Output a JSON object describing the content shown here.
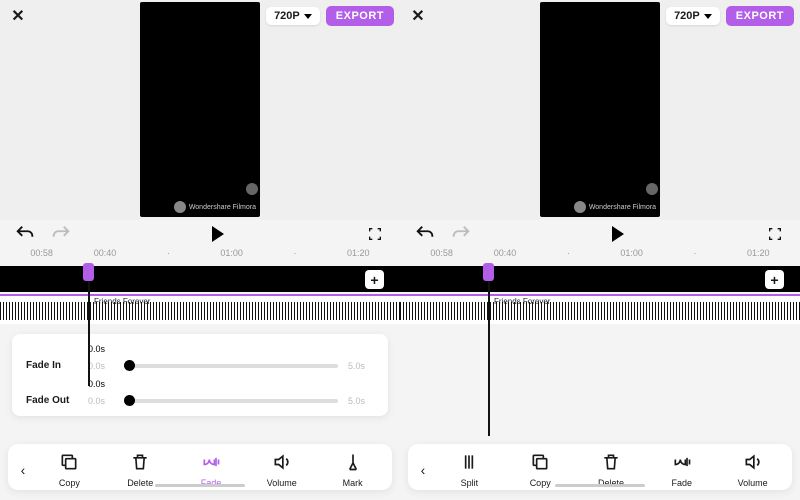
{
  "header": {
    "quality": "720P",
    "export": "EXPORT"
  },
  "watermark": "Wondershare Filmora",
  "ruler": [
    "00:58",
    "00:40",
    "·",
    "01:00",
    "·",
    "01:20"
  ],
  "audio": {
    "label": "Friends Forever"
  },
  "fade": {
    "in_label": "Fade In",
    "out_label": "Fade Out",
    "in_min": "0.0s",
    "in_max": "5.0s",
    "in_cur": "0.0s",
    "out_min": "0.0s",
    "out_max": "5.0s",
    "out_cur": "0.0s"
  },
  "left_tools": [
    {
      "id": "copy",
      "label": "Copy"
    },
    {
      "id": "delete",
      "label": "Delete"
    },
    {
      "id": "fade",
      "label": "Fade",
      "active": true
    },
    {
      "id": "volume",
      "label": "Volume"
    },
    {
      "id": "mark",
      "label": "Mark"
    }
  ],
  "right_tools": [
    {
      "id": "split",
      "label": "Split"
    },
    {
      "id": "copy",
      "label": "Copy"
    },
    {
      "id": "delete",
      "label": "Delete"
    },
    {
      "id": "fade",
      "label": "Fade"
    },
    {
      "id": "volume",
      "label": "Volume"
    }
  ]
}
